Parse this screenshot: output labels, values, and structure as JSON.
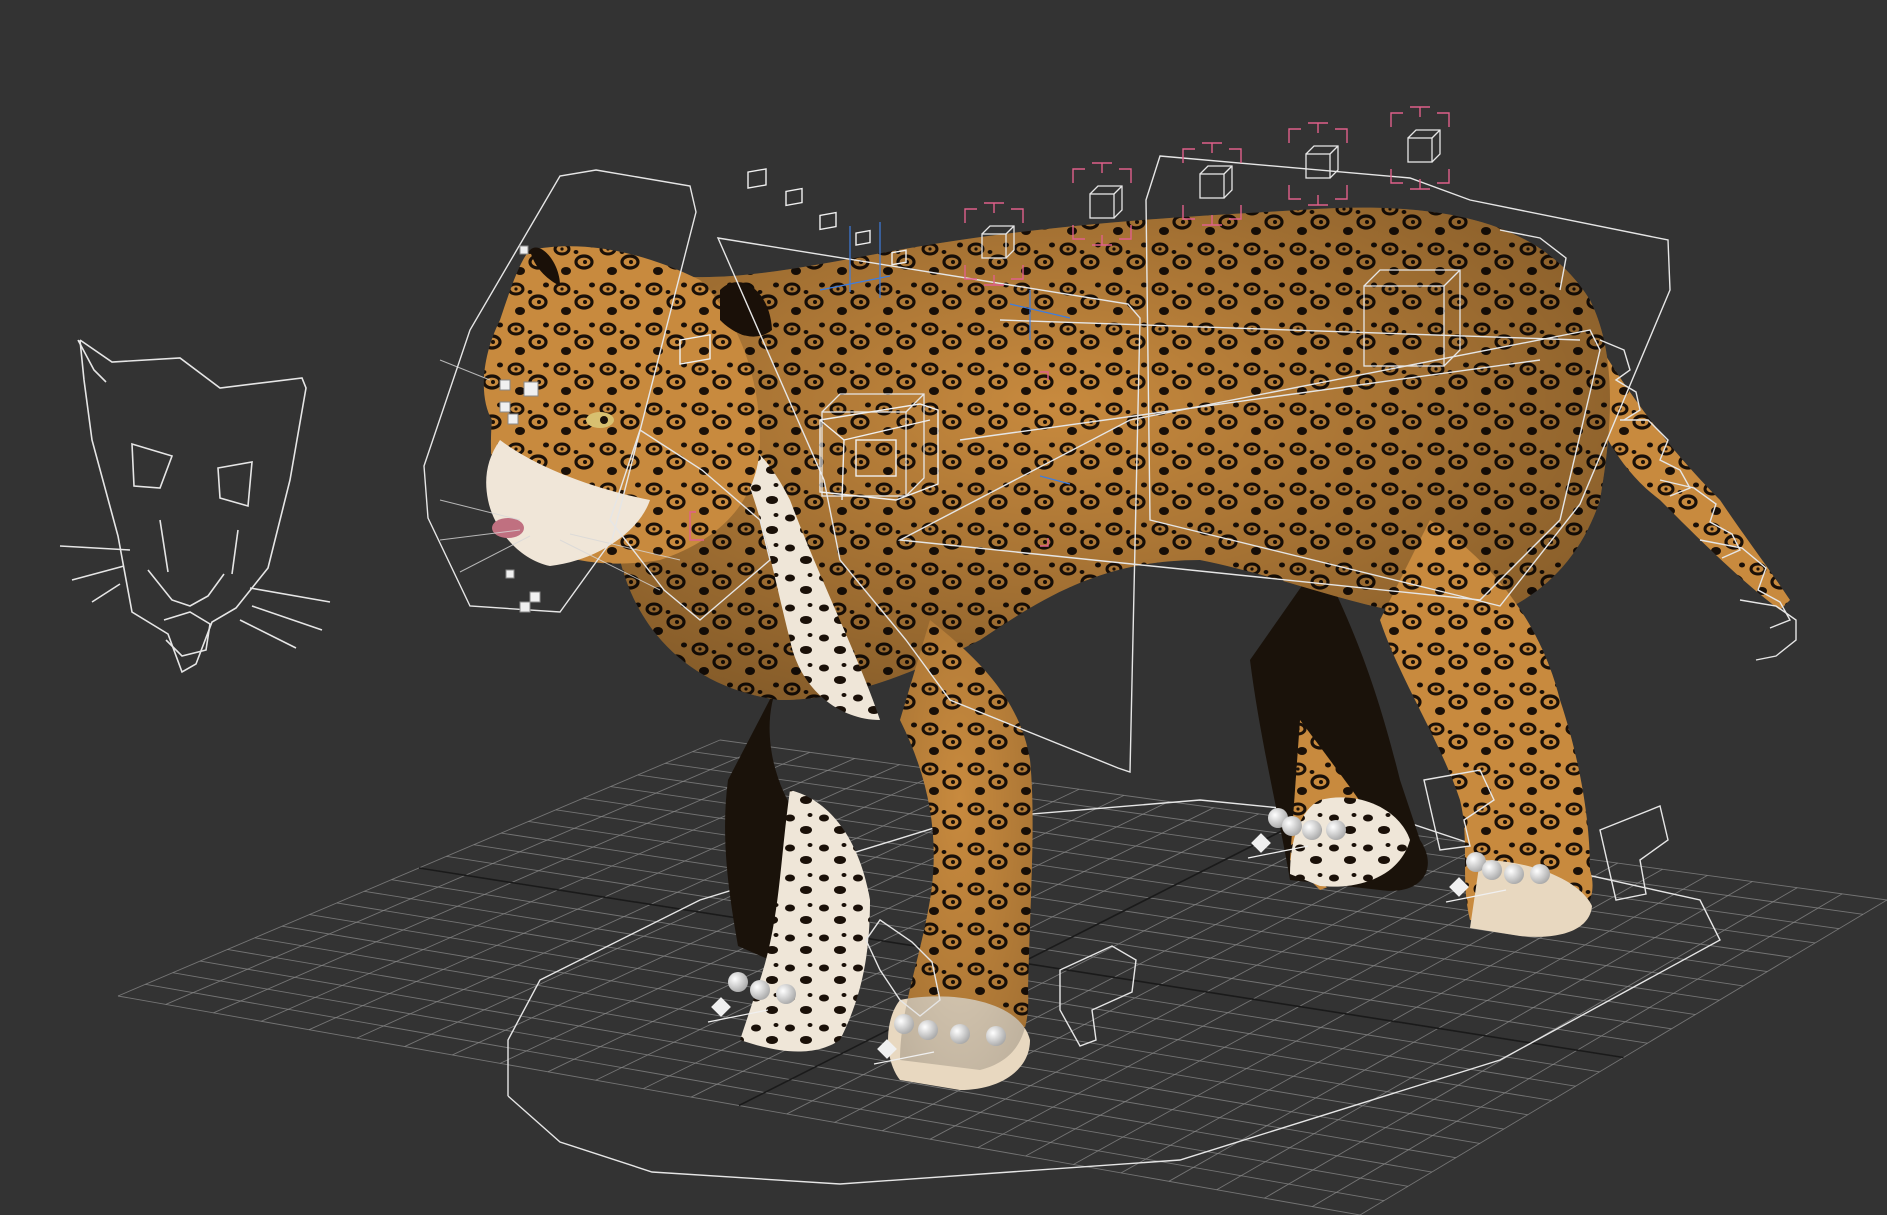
{
  "viewport": {
    "background": "#333333",
    "grid_color": "#8a8a8a",
    "grid_axis_color": "#1a1a1a",
    "rig_line_color": "#e6e6e6",
    "ik_helper_color": "#e0608a",
    "bone_axis_color": "#3d7de0",
    "jaguar_fur_color": "#c88a3e",
    "jaguar_belly_color": "#f0e6d8",
    "jaguar_spot_color": "#1a1008",
    "character_picker_icon": "cat-face-wireframe-icon"
  }
}
